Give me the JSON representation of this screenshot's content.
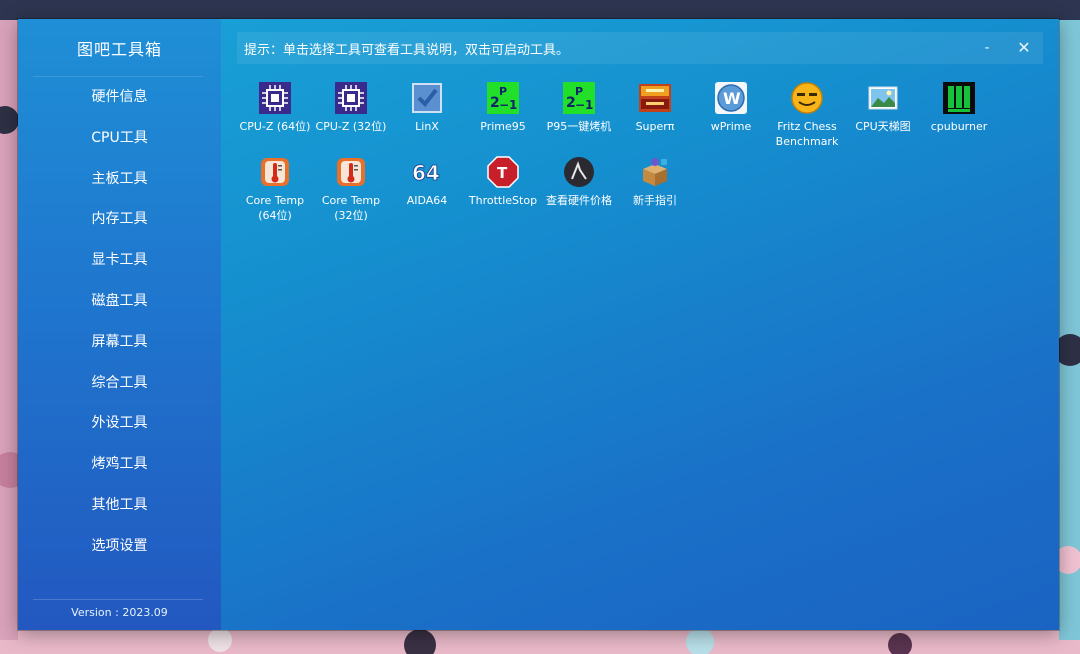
{
  "app": {
    "title": "图吧工具箱",
    "version": "Version : 2023.09"
  },
  "hint": "提示：单击选择工具可查看工具说明，双击可启动工具。",
  "window_controls": {
    "minimize": "-",
    "close": "✕"
  },
  "nav": [
    "硬件信息",
    "CPU工具",
    "主板工具",
    "内存工具",
    "显卡工具",
    "磁盘工具",
    "屏幕工具",
    "综合工具",
    "外设工具",
    "烤鸡工具",
    "其他工具",
    "选项设置"
  ],
  "tools": [
    {
      "label": "CPU-Z (64位)",
      "icon": "cpu-chip-icon"
    },
    {
      "label": "CPU-Z (32位)",
      "icon": "cpu-chip-icon"
    },
    {
      "label": "LinX",
      "icon": "check-box-icon"
    },
    {
      "label": "Prime95",
      "icon": "prime95-icon"
    },
    {
      "label": "P95一键烤机",
      "icon": "prime95-icon"
    },
    {
      "label": "Superπ",
      "icon": "superpi-icon"
    },
    {
      "label": "wPrime",
      "icon": "wprime-icon"
    },
    {
      "label": "Fritz Chess\nBenchmark",
      "icon": "smiley-face-icon"
    },
    {
      "label": "CPU天梯图",
      "icon": "landscape-image-icon"
    },
    {
      "label": "cpuburner",
      "icon": "cpuburner-icon"
    },
    {
      "label": "Core Temp\n(64位)",
      "icon": "thermometer-icon"
    },
    {
      "label": "Core Temp\n(32位)",
      "icon": "thermometer-icon"
    },
    {
      "label": "AIDA64",
      "icon": "aida64-icon"
    },
    {
      "label": "ThrottleStop",
      "icon": "stop-sign-icon"
    },
    {
      "label": "查看硬件价格",
      "icon": "price-chart-icon"
    },
    {
      "label": "新手指引",
      "icon": "guide-box-icon"
    }
  ],
  "colors": {
    "window_top": "#1aa4d8",
    "window_bottom": "#1a63c2",
    "sidebar": "#1f74cd"
  }
}
